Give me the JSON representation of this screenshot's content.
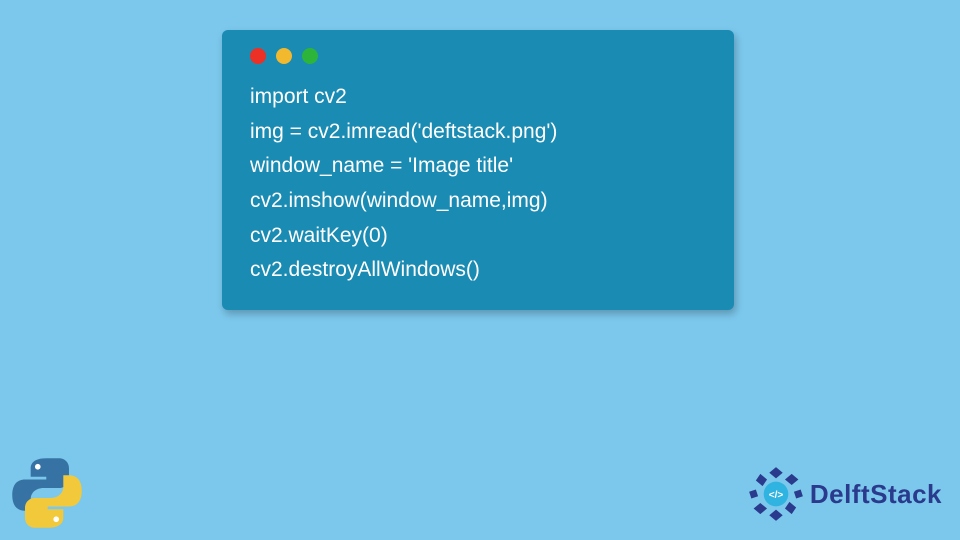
{
  "code": {
    "lines": [
      "import cv2",
      "img = cv2.imread('deftstack.png')",
      "window_name = 'Image title'",
      "cv2.imshow(window_name,img)",
      "cv2.waitKey(0)",
      "cv2.destroyAllWindows()"
    ]
  },
  "brand": {
    "name": "DelftStack"
  }
}
